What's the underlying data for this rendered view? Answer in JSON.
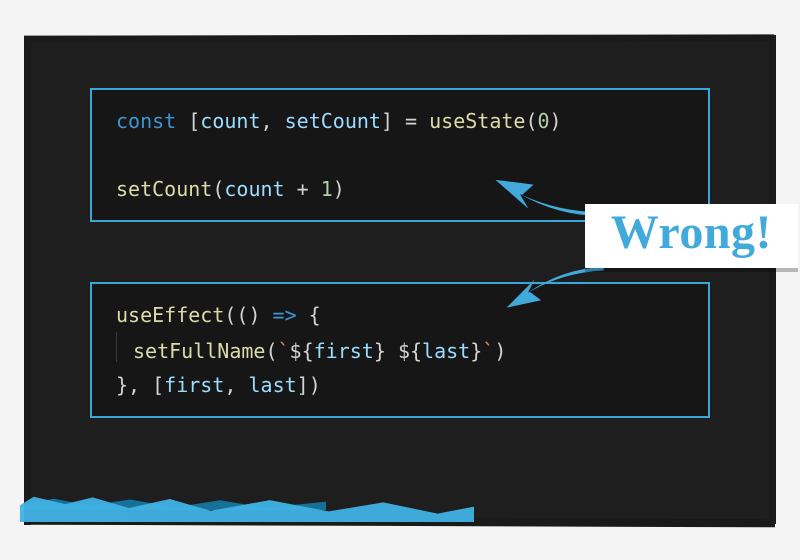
{
  "colors": {
    "accent": "#42a9db",
    "editor_bg": "#1e1e1e",
    "box_border": "#3aa7d9"
  },
  "boxes": {
    "top": {
      "lines": [
        [
          {
            "t": "const ",
            "cls": "kw"
          },
          {
            "t": "[",
            "cls": "pun"
          },
          {
            "t": "count",
            "cls": "var"
          },
          {
            "t": ", ",
            "cls": "pun"
          },
          {
            "t": "setCount",
            "cls": "var"
          },
          {
            "t": "] = ",
            "cls": "pun"
          },
          {
            "t": "useState",
            "cls": "fn"
          },
          {
            "t": "(",
            "cls": "pun"
          },
          {
            "t": "0",
            "cls": "num"
          },
          {
            "t": ")",
            "cls": "pun"
          }
        ],
        [],
        [
          {
            "t": "setCount",
            "cls": "fn"
          },
          {
            "t": "(",
            "cls": "pun"
          },
          {
            "t": "count",
            "cls": "var"
          },
          {
            "t": " + ",
            "cls": "pun"
          },
          {
            "t": "1",
            "cls": "num"
          },
          {
            "t": ")",
            "cls": "pun"
          }
        ]
      ]
    },
    "bottom": {
      "lines": [
        [
          {
            "t": "useEffect",
            "cls": "fn"
          },
          {
            "t": "(",
            "cls": "pun"
          },
          {
            "t": "() ",
            "cls": "pun"
          },
          {
            "t": "=>",
            "cls": "arrow"
          },
          {
            "t": " {",
            "cls": "pun"
          }
        ],
        [
          {
            "indent": true
          },
          {
            "t": "setFullName",
            "cls": "fn"
          },
          {
            "t": "(",
            "cls": "pun"
          },
          {
            "t": "`",
            "cls": "str"
          },
          {
            "t": "${",
            "cls": "pun"
          },
          {
            "t": "first",
            "cls": "var"
          },
          {
            "t": "}",
            "cls": "pun"
          },
          {
            "t": " ",
            "cls": "str"
          },
          {
            "t": "${",
            "cls": "pun"
          },
          {
            "t": "last",
            "cls": "var"
          },
          {
            "t": "}",
            "cls": "pun"
          },
          {
            "t": "`",
            "cls": "str"
          },
          {
            "t": ")",
            "cls": "pun"
          }
        ],
        [
          {
            "t": "}, [",
            "cls": "pun"
          },
          {
            "t": "first",
            "cls": "var"
          },
          {
            "t": ", ",
            "cls": "pun"
          },
          {
            "t": "last",
            "cls": "var"
          },
          {
            "t": "])",
            "cls": "pun"
          }
        ]
      ]
    }
  },
  "callout": {
    "label": "Wrong!"
  }
}
